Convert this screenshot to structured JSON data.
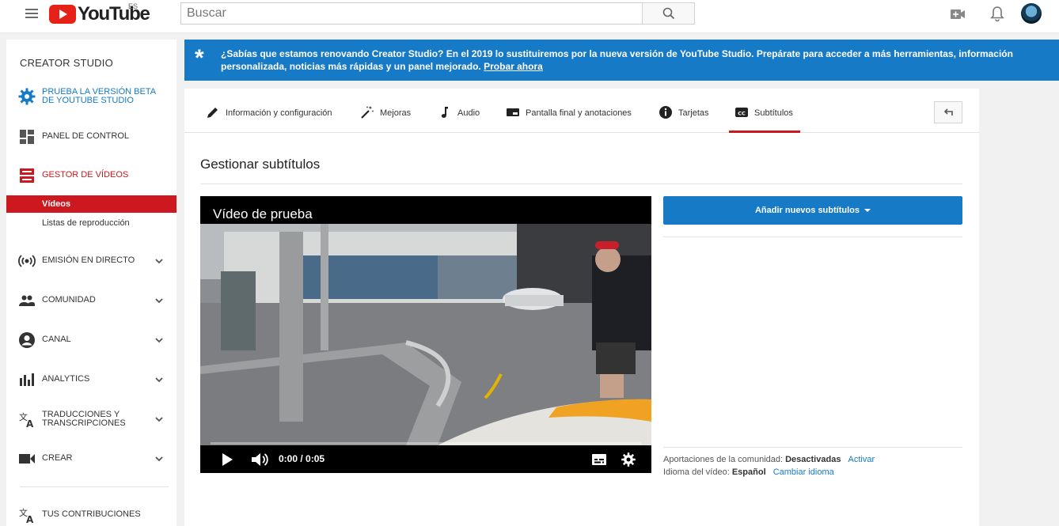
{
  "topbar": {
    "logo_text": "YouTube",
    "logo_region": "ES",
    "search_placeholder": "Buscar",
    "icons": [
      "menu-icon",
      "search-icon",
      "create-video-icon",
      "notifications-bell-icon",
      "avatar"
    ]
  },
  "sidebar": {
    "title": "CREATOR STUDIO",
    "beta_line1": "PRUEBA LA VERSIÓN BETA",
    "beta_line2": "DE YOUTUBE STUDIO",
    "dashboard": "PANEL DE CONTROL",
    "video_manager": "GESTOR DE VÍDEOS",
    "videos": "Vídeos",
    "playlists": "Listas de reproducción",
    "live": "EMISIÓN EN DIRECTO",
    "community": "COMUNIDAD",
    "channel": "CANAL",
    "analytics": "ANALYTICS",
    "translations_line1": "TRADUCCIONES Y",
    "translations_line2": "TRANSCRIPCIONES",
    "create": "CREAR",
    "contributions": "TUS CONTRIBUCIONES"
  },
  "banner": {
    "message": "¿Sabías que estamos renovando Creator Studio? En el 2019 lo sustituiremos por la nueva versión de YouTube Studio. Prepárate para acceder a más herramientas, información personalizada, noticias más rápidas y un panel mejorado.",
    "link": "Probar ahora"
  },
  "tabs": [
    {
      "label": "Información y configuración",
      "icon": "pencil-icon"
    },
    {
      "label": "Mejoras",
      "icon": "magic-wand-icon"
    },
    {
      "label": "Audio",
      "icon": "music-note-icon"
    },
    {
      "label": "Pantalla final y anotaciones",
      "icon": "end-screen-icon"
    },
    {
      "label": "Tarjetas",
      "icon": "info-circle-icon"
    },
    {
      "label": "Subtítulos",
      "icon": "cc-icon",
      "active": true
    }
  ],
  "page_title": "Gestionar subtítulos",
  "video": {
    "title": "Vídeo de prueba",
    "time": "0:00 / 0:05"
  },
  "right_panel": {
    "add_button": "Añadir nuevos subtítulos",
    "community_label": "Aportaciones de la comunidad:",
    "community_value": "Desactivadas",
    "community_action": "Activar",
    "language_label": "Idioma del vídeo:",
    "language_value": "Español",
    "language_action": "Cambiar idioma"
  },
  "colors": {
    "brand_red": "#cc181e",
    "accent_blue": "#167ac6"
  }
}
